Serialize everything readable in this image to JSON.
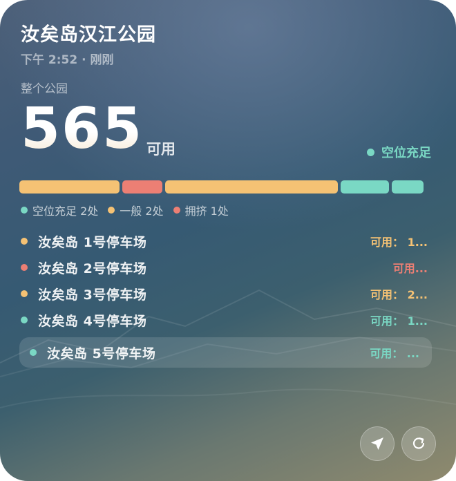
{
  "park": {
    "title": "汝矣岛汉江公园",
    "updated": "下午 2:52 · 刚刚",
    "scope": "整个公园",
    "available_count": "565",
    "available_unit": "可用",
    "status_label": "空位充足"
  },
  "colors": {
    "ample": "#7ad8c4",
    "normal": "#f5c274",
    "crowded": "#ec7f74"
  },
  "status_bar": [
    {
      "status": "normal",
      "share": 0.25
    },
    {
      "status": "crowded",
      "share": 0.1
    },
    {
      "status": "normal",
      "share": 0.43
    },
    {
      "status": "ample",
      "share": 0.12
    },
    {
      "status": "ample",
      "share": 0.08
    }
  ],
  "legend": [
    {
      "status": "ample",
      "label": "空位充足 2处"
    },
    {
      "status": "normal",
      "label": "一般 2处"
    },
    {
      "status": "crowded",
      "label": "拥挤 1处"
    }
  ],
  "lots": [
    {
      "status": "normal",
      "name": "汝矣岛 1号停车场",
      "availability": "可用： 1..."
    },
    {
      "status": "crowded",
      "name": "汝矣岛 2号停车场",
      "availability": "可用..."
    },
    {
      "status": "normal",
      "name": "汝矣岛 3号停车场",
      "availability": "可用： 2..."
    },
    {
      "status": "ample",
      "name": "汝矣岛 4号停车场",
      "availability": "可用： 1..."
    },
    {
      "status": "ample",
      "name": "汝矣岛 5号停车场",
      "availability": "可用： ..."
    }
  ],
  "actions": {
    "locate_icon": "location-arrow-icon",
    "refresh_icon": "refresh-icon"
  }
}
